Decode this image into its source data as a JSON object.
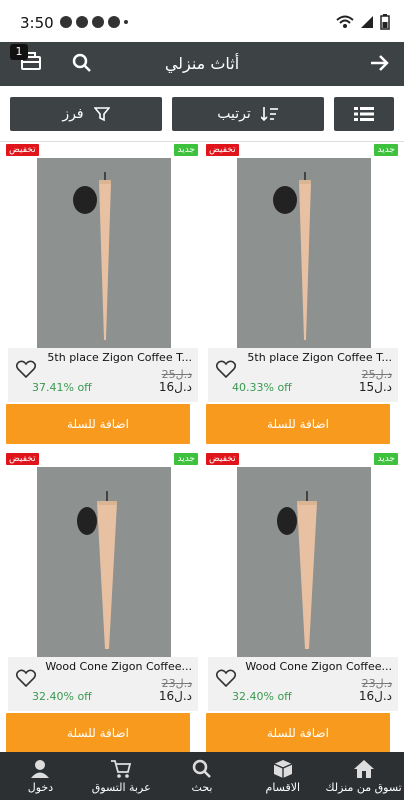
{
  "status": {
    "time": "3:50"
  },
  "appbar": {
    "title": "أثاث منزلي",
    "cart_count": "1"
  },
  "filters": {
    "filter_label": "فرز",
    "sort_label": "ترتيب"
  },
  "products": [
    {
      "name": "5th place Zigon Coffee T...",
      "old_price": "25د.ل",
      "price": "15د.ل",
      "discount": "40.33% off",
      "button": "اضافة للسلة",
      "tag_sale": "تخفيض",
      "tag_new": "جديد"
    },
    {
      "name": "5th place Zigon Coffee T...",
      "old_price": "25د.ل",
      "price": "16د.ل",
      "discount": "37.41% off",
      "button": "اضافة للسلة",
      "tag_sale": "تخفيض",
      "tag_new": "جديد"
    },
    {
      "name": "Wood Cone Zigon Coffee...",
      "old_price": "23د.ل",
      "price": "16د.ل",
      "discount": "32.40% off",
      "button": "اضافة للسلة",
      "tag_sale": "تخفيض",
      "tag_new": "جديد"
    },
    {
      "name": "Wood Cone Zigon Coffee...",
      "old_price": "23د.ل",
      "price": "16د.ل",
      "discount": "32.40% off",
      "button": "اضافة للسلة",
      "tag_sale": "تخفيض",
      "tag_new": "جديد"
    }
  ],
  "bottom_nav": [
    {
      "label": "تسوق من منزلك",
      "icon": "house-icon"
    },
    {
      "label": "الاقسام",
      "icon": "cube-icon"
    },
    {
      "label": "بحث",
      "icon": "search-icon"
    },
    {
      "label": "عربة التسوق",
      "icon": "cart-icon"
    },
    {
      "label": "دخول",
      "icon": "user-icon"
    }
  ],
  "colors": {
    "appbar": "#3d4245",
    "add_button": "#f79a1e",
    "sale_tag": "#e0151b",
    "new_tag": "#3ec23e",
    "discount_text": "#3a9a50"
  }
}
